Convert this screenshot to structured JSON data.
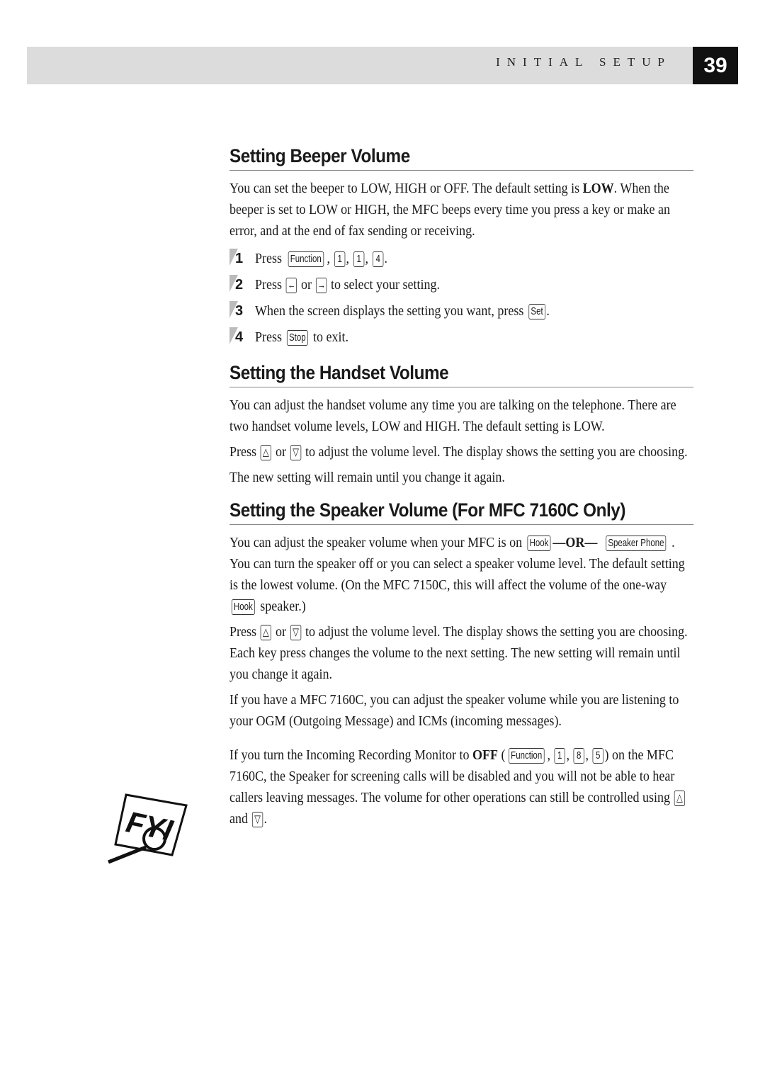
{
  "header": {
    "section_label": "INITIAL SETUP",
    "page_number": "39"
  },
  "sections": [
    {
      "title": "Setting Beeper Volume",
      "intro": [
        "You can set the beeper to LOW, HIGH or OFF. The default setting is ",
        "LOW",
        ". When the beeper is set to LOW or HIGH, the MFC beeps every time you press a key or make an error, and at the end of fax sending or receiving."
      ],
      "steps": [
        {
          "num": "1",
          "pre": "Press ",
          "keys": [
            "Function",
            "1",
            "1",
            "4"
          ],
          "post": "."
        },
        {
          "num": "2",
          "pre": "Press ",
          "key_a": "left-arrow",
          "mid": " or ",
          "key_b": "right-arrow",
          "post": " to select your setting."
        },
        {
          "num": "3",
          "pre": "When the screen displays the setting you want, press ",
          "key": "Set",
          "post": "."
        },
        {
          "num": "4",
          "pre": "Press ",
          "key": "Stop",
          "post": " to exit."
        }
      ]
    },
    {
      "title": "Setting the Handset Volume",
      "p1": "You can adjust the handset volume any time you are talking on the telephone. There are two handset volume levels, LOW and HIGH. The default setting is LOW.",
      "p2_pre": "Press ",
      "p2_mid": " or ",
      "p2_post": " to adjust the volume level.  The display shows the setting you are choosing.",
      "p3": "The new setting will remain until you change it again."
    },
    {
      "title": "Setting the Speaker Volume (For MFC 7160C Only)",
      "p1_a": "You can adjust the speaker volume when your MFC is on ",
      "key_hook": "Hook",
      "or_text": "—OR—",
      "key_speaker": "Speaker Phone",
      "p1_b": ". You can turn the speaker off or you can select a speaker volume level. The default setting is the lowest volume. (On the MFC 7150C, this will affect the volume of the one-way ",
      "p1_c": " speaker.)",
      "p2_pre": "Press ",
      "p2_mid": " or ",
      "p2_post": " to adjust the volume level. The display shows the setting you are choosing. Each key press changes the volume to the next setting. The new setting will remain until you change it again.",
      "p3": "If you have a MFC 7160C, you can adjust the speaker volume while you are listening to your OGM (Outgoing Message) and ICMs (incoming messages)."
    }
  ],
  "fyi": {
    "icon_label": "FYI",
    "text_a": "If you turn the Incoming Recording Monitor to ",
    "off": "OFF",
    "keys": [
      "Function",
      "1",
      "8",
      "5"
    ],
    "text_b": " on the MFC 7160C, the Speaker for screening calls will be disabled and you will not be able to hear callers leaving messages. The volume for other operations can still be controlled using ",
    "and": " and ",
    "end": "."
  }
}
